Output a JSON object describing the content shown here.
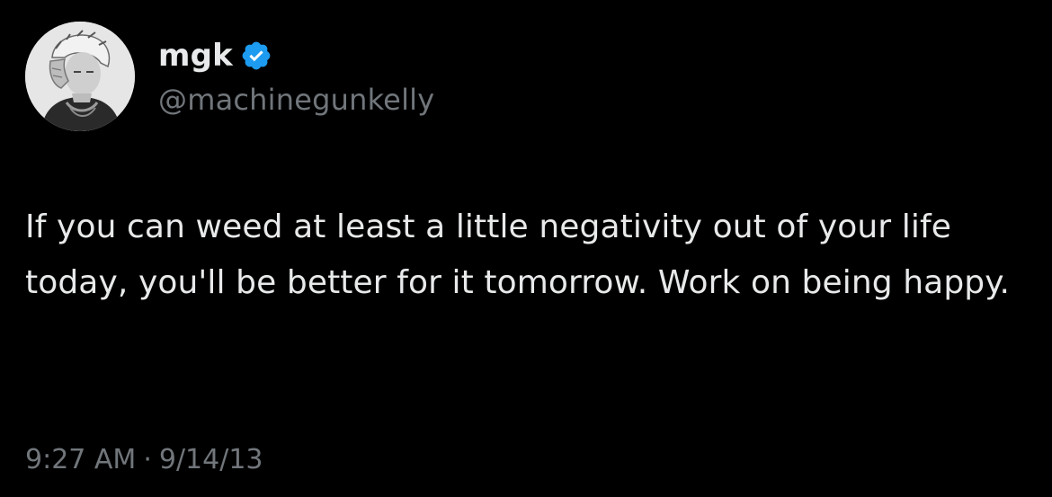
{
  "user": {
    "display_name": "mgk",
    "handle": "@machinegunkelly",
    "verified": true,
    "verified_badge_color": "#1d9bf0"
  },
  "tweet": {
    "text": "If you can weed at least a little negativity out of your life today, you'll be better for it tomorrow. Work on being happy.",
    "time": "9:27 AM",
    "separator": "·",
    "date": "9/14/13"
  },
  "colors": {
    "background": "#000000",
    "primary_text": "#e7e9ea",
    "secondary_text": "#71767b"
  },
  "icons": {
    "avatar": "profile-photo",
    "badge": "verified-badge-icon"
  }
}
